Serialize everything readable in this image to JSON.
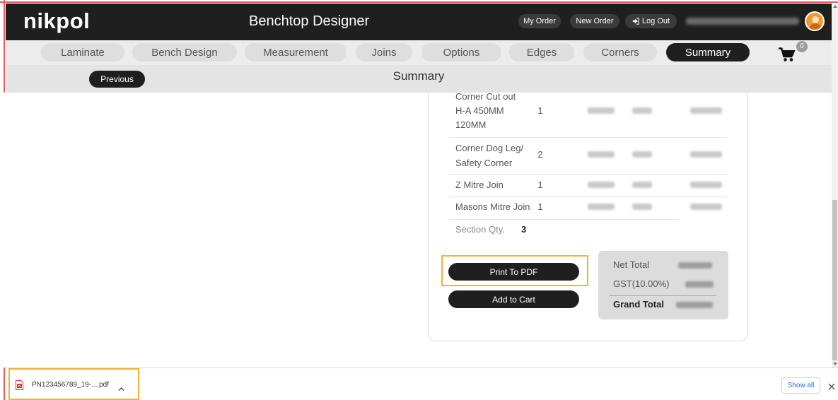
{
  "header": {
    "logo": "nikpol",
    "title": "Benchtop Designer",
    "my_order": "My Order",
    "new_order": "New Order",
    "log_out": "Log Out",
    "log_out_icon": "logout-icon",
    "avatar_icon": "avatar"
  },
  "nav": {
    "tabs": [
      {
        "label": "Laminate",
        "active": false
      },
      {
        "label": "Bench Design",
        "active": false
      },
      {
        "label": "Measurement",
        "active": false
      },
      {
        "label": "Joins",
        "active": false
      },
      {
        "label": "Options",
        "active": false
      },
      {
        "label": "Edges",
        "active": false
      },
      {
        "label": "Corners",
        "active": false
      },
      {
        "label": "Summary",
        "active": true
      }
    ],
    "cart_icon": "cart-icon",
    "cart_count": "0"
  },
  "subheader": {
    "previous": "Previous",
    "title": "Summary"
  },
  "summary": {
    "rows": [
      {
        "description": [
          "Corner Cut out",
          "H-A 450MM",
          "120MM"
        ],
        "qty": "1"
      },
      {
        "description": [
          "Corner Dog Leg/",
          "Safety Corner"
        ],
        "qty": "2"
      },
      {
        "description": [
          "Z Mitre Join"
        ],
        "qty": "1"
      },
      {
        "description": [
          "Masons Mitre Join"
        ],
        "qty": "1"
      }
    ],
    "section_qty_label": "Section Qty.",
    "section_qty": "3",
    "print_pdf": "Print To PDF",
    "add_to_cart": "Add to Cart",
    "totals": {
      "net_total_label": "Net Total",
      "gst_label": "GST(10.00%)",
      "grand_total_label": "Grand Total"
    }
  },
  "downloads": {
    "file_icon": "pdf-icon",
    "file_name": "PN123456789_19-....pdf",
    "chevron_icon": "chevron-up-icon",
    "show_all": "Show all",
    "close_icon": "close-icon"
  },
  "colors": {
    "header_bg": "#1f1f1f",
    "active_tab_bg": "#1f1f1f",
    "highlight": "#f2b233",
    "frame": "#e06060",
    "link": "#1a73e8",
    "avatar": "#f29a2e"
  }
}
